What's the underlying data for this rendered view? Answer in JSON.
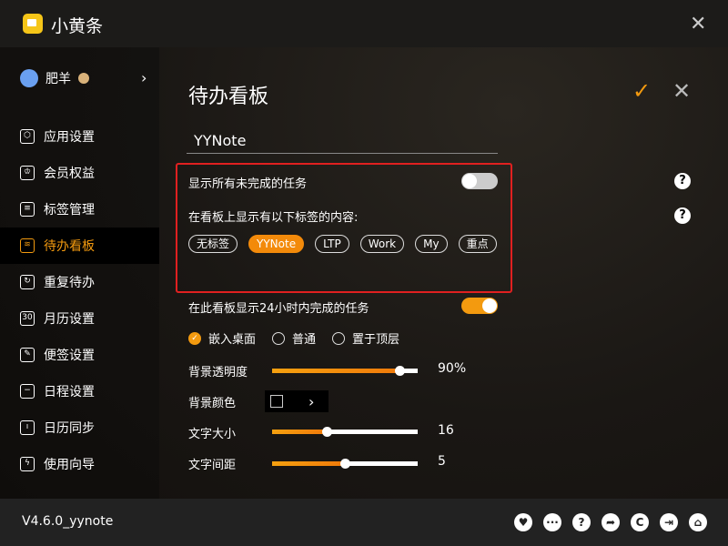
{
  "app": {
    "title": "小黄条",
    "accent": "#f39a0f"
  },
  "user": {
    "name": "肥羊"
  },
  "sidebar": {
    "items": [
      {
        "label": "应用设置",
        "icon": "hexagon-icon"
      },
      {
        "label": "会员权益",
        "icon": "crown-icon"
      },
      {
        "label": "标签管理",
        "icon": "tag-list-icon"
      },
      {
        "label": "待办看板",
        "icon": "layers-icon",
        "active": true
      },
      {
        "label": "重复待办",
        "icon": "repeat-icon"
      },
      {
        "label": "月历设置",
        "icon": "calendar-30-icon",
        "glyph": "30"
      },
      {
        "label": "便签设置",
        "icon": "note-edit-icon"
      },
      {
        "label": "日程设置",
        "icon": "schedule-icon"
      },
      {
        "label": "日历同步",
        "icon": "calendar-sync-icon"
      },
      {
        "label": "使用向导",
        "icon": "guide-icon"
      }
    ]
  },
  "main": {
    "title": "待办看板",
    "board_name": "YYNote",
    "show_all_unfinished": {
      "label": "显示所有未完成的任务",
      "on": false
    },
    "tags_label": "在看板上显示有以下标签的内容:",
    "tags": [
      {
        "label": "无标签",
        "selected": false
      },
      {
        "label": "YYNote",
        "selected": true
      },
      {
        "label": "LTP",
        "selected": false
      },
      {
        "label": "Work",
        "selected": false
      },
      {
        "label": "My",
        "selected": false
      },
      {
        "label": "重点",
        "selected": false
      }
    ],
    "show_24h": {
      "label": "在此看板显示24小时内完成的任务",
      "on": true
    },
    "modes": [
      {
        "label": "嵌入桌面",
        "selected": true
      },
      {
        "label": "普通",
        "selected": false
      },
      {
        "label": "置于顶层",
        "selected": false
      }
    ],
    "opacity": {
      "label": "背景透明度",
      "value": "90%",
      "level": 0.875
    },
    "bg_color": {
      "label": "背景颜色",
      "color": "#000000"
    },
    "font_size": {
      "label": "文字大小",
      "value": "16",
      "level": 0.375
    },
    "spacing": {
      "label": "文字间距",
      "value": "5",
      "level": 0.5
    }
  },
  "footer": {
    "version": "V4.6.0_yynote",
    "icons": [
      "heart-icon",
      "chat-icon",
      "help-icon",
      "share-icon",
      "refresh-icon",
      "exit-icon",
      "home-icon"
    ]
  }
}
